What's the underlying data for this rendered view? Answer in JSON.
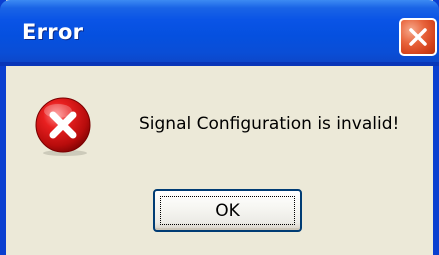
{
  "window": {
    "title": "Error"
  },
  "dialog": {
    "icon": "error-icon",
    "message": "Signal Configuration is invalid!",
    "ok_label": "OK"
  },
  "colors": {
    "titlebar": "#0550df",
    "dialog_bg": "#ece9d8",
    "close_button": "#d3401a",
    "error_icon": "#c81010"
  }
}
